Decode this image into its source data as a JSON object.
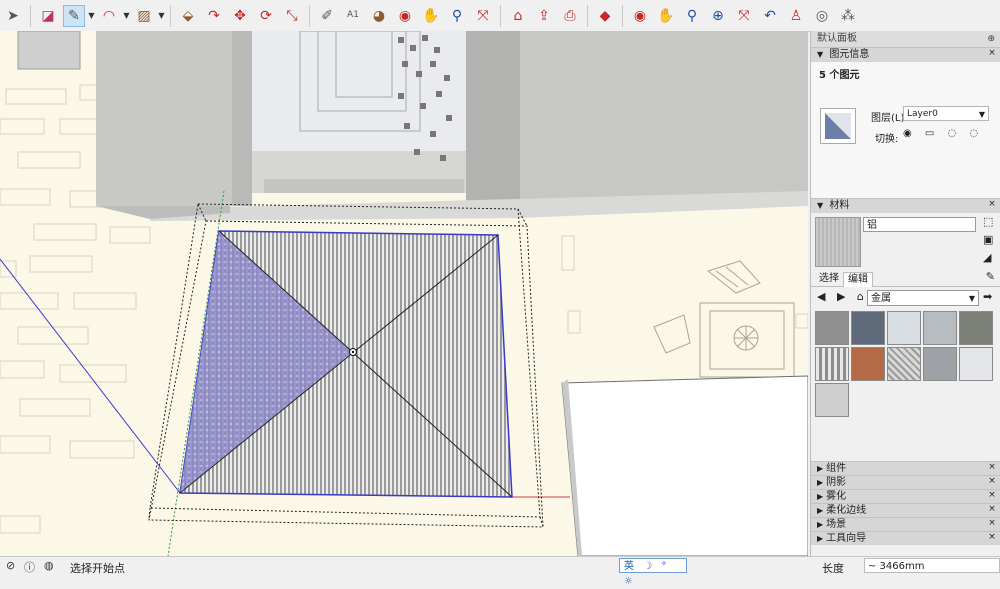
{
  "toolbar": {
    "tools": [
      {
        "name": "select",
        "glyph": "➤"
      },
      {
        "name": "eraser",
        "glyph": "◪"
      },
      {
        "name": "pencil",
        "glyph": "✎"
      },
      {
        "name": "arc",
        "glyph": "◠"
      },
      {
        "name": "rectangle",
        "glyph": "▨"
      },
      {
        "name": "push-pull",
        "glyph": "⬙"
      },
      {
        "name": "follow-me",
        "glyph": "↷"
      },
      {
        "name": "move",
        "glyph": "✥"
      },
      {
        "name": "rotate",
        "glyph": "⟳"
      },
      {
        "name": "scale",
        "glyph": "⤡"
      },
      {
        "name": "tape-measure",
        "glyph": "✐"
      },
      {
        "name": "text",
        "glyph": "A1"
      },
      {
        "name": "paint-bucket",
        "glyph": "◕"
      },
      {
        "name": "orbit",
        "glyph": "◉"
      },
      {
        "name": "pan",
        "glyph": "✋"
      },
      {
        "name": "zoom",
        "glyph": "⚲"
      },
      {
        "name": "zoom-extents",
        "glyph": "⤧"
      },
      {
        "name": "warehouse",
        "glyph": "⌂"
      },
      {
        "name": "share-model",
        "glyph": "⇪"
      },
      {
        "name": "send-to-layout",
        "glyph": "⎙"
      },
      {
        "name": "extension-warehouse",
        "glyph": "◆"
      },
      {
        "name": "orbit-2",
        "glyph": "◉"
      },
      {
        "name": "pan-2",
        "glyph": "✋"
      },
      {
        "name": "zoom-2",
        "glyph": "⚲"
      },
      {
        "name": "zoom-window",
        "glyph": "⊕"
      },
      {
        "name": "zoom-extents-2",
        "glyph": "⤧"
      },
      {
        "name": "previous-view",
        "glyph": "↶"
      },
      {
        "name": "position-camera",
        "glyph": "♙"
      },
      {
        "name": "look-around",
        "glyph": "◎"
      },
      {
        "name": "walk",
        "glyph": "⁂"
      }
    ]
  },
  "panel": {
    "title": "默认面板",
    "entity_info": {
      "header": "图元信息",
      "count": "5 个图元",
      "layer_label": "图层(L):",
      "layer_value": "Layer0",
      "toggle_label": "切换:",
      "toggle_icons": "◉ ▭ ◌ ◌"
    },
    "materials": {
      "header": "材料",
      "name_value": "铝",
      "tab_select": "选择",
      "tab_edit": "编辑",
      "nav_icons": "◀ ▶ ⌂",
      "collection": "金属",
      "swatch_colors": [
        "#8f8f8f",
        "#5f6a7a",
        "#d8dde3",
        "#b7bcc1",
        "#7d7f79",
        "#a9a9a9",
        "#b46a47",
        "#c9c9c9",
        "#9ea2a6",
        "#e4e5e8",
        "#cfcfcf"
      ]
    },
    "collapsed_sections": [
      "组件",
      "阴影",
      "雾化",
      "柔化边线",
      "场景",
      "工具向导"
    ]
  },
  "status": {
    "text": "选择开始点",
    "ime": "英 ☽ ° ☼",
    "length_label": "长度",
    "length_value": "~ 3466mm"
  },
  "colors": {
    "accent": "#cce4f7",
    "viewport_bg": "#fbf8e7",
    "selection_blue": "#3a3ac9",
    "axis_red": "#d13b3b",
    "axis_green": "#2e9e3b"
  }
}
